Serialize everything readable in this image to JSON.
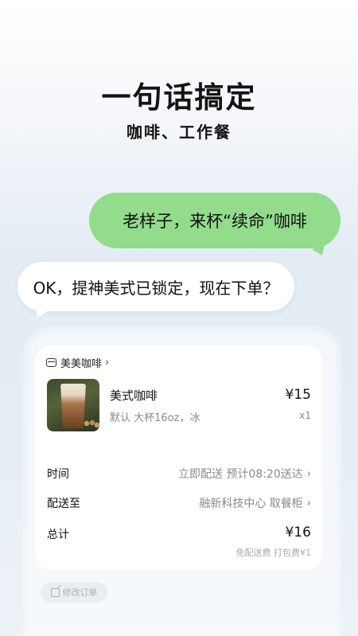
{
  "hero": {
    "title": "一句话搞定",
    "subtitle": "咖啡、工作餐"
  },
  "chat": {
    "user_message": "老样子，来杯“续命”咖啡",
    "bot_message": "OK，提神美式已锁定，现在下单？"
  },
  "order": {
    "store_name": "美美咖啡",
    "store_icon": "store-icon",
    "item": {
      "name": "美式咖啡",
      "spec": "默认 大杯16oz，冰",
      "price": "¥15",
      "quantity": "x1"
    },
    "time": {
      "label": "时间",
      "value": "立即配送 预计08:20送达"
    },
    "delivery": {
      "label": "配送至",
      "value": "融新科技中心 取餐柜"
    },
    "total": {
      "label": "总计",
      "value": "¥16",
      "fees": "免配送费 打包费¥1"
    },
    "modify_label": "修改订单"
  },
  "colors": {
    "user_bubble": "#92dc8c",
    "bot_bubble": "#ffffff",
    "card": "#ffffff"
  }
}
